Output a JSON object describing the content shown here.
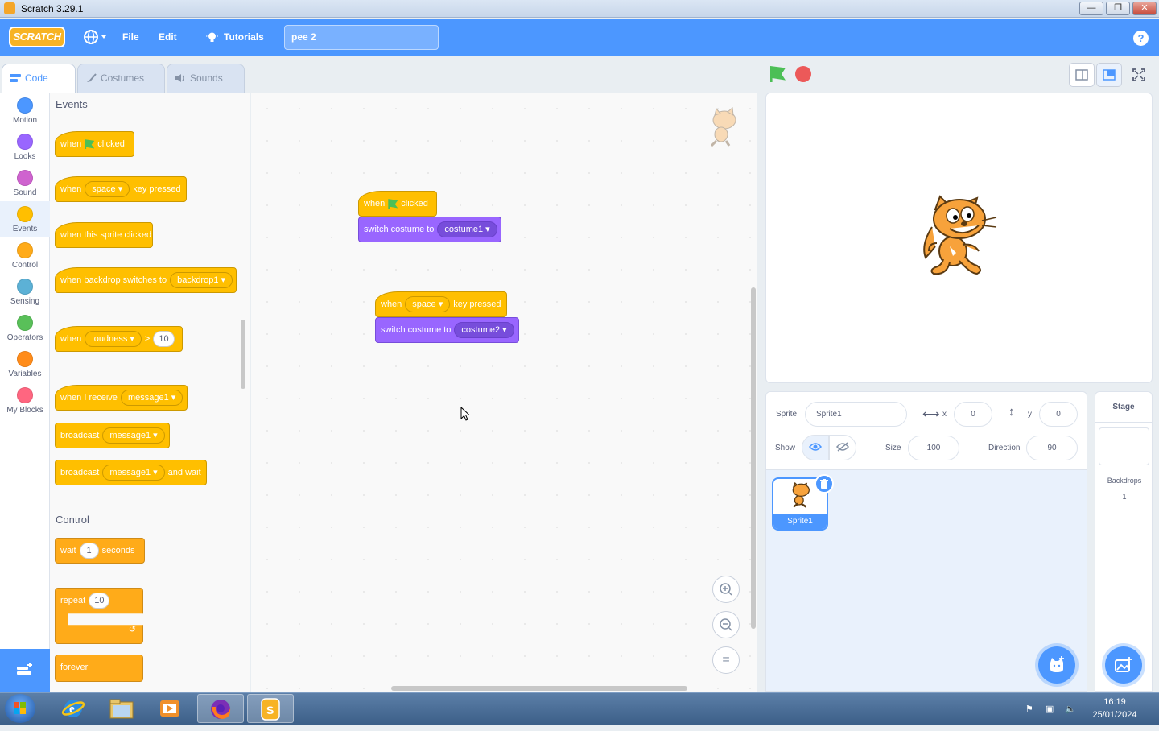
{
  "window": {
    "title": "Scratch 3.29.1",
    "buttons": [
      "—",
      "❐",
      "✕"
    ]
  },
  "menubar": {
    "logo": "SCRATCH",
    "globe_icon": "globe-icon",
    "file": "File",
    "edit": "Edit",
    "tutorials": "Tutorials",
    "project_name": "pee 2",
    "help": "?"
  },
  "tabs": [
    {
      "label": "Code",
      "icon": "code-icon"
    },
    {
      "label": "Costumes",
      "icon": "brush-icon"
    },
    {
      "label": "Sounds",
      "icon": "speaker-icon"
    }
  ],
  "categories": [
    {
      "label": "Motion",
      "color": "#4c97ff"
    },
    {
      "label": "Looks",
      "color": "#9966ff"
    },
    {
      "label": "Sound",
      "color": "#cf63cf"
    },
    {
      "label": "Events",
      "color": "#ffbf00"
    },
    {
      "label": "Control",
      "color": "#ffab19"
    },
    {
      "label": "Sensing",
      "color": "#5cb1d6"
    },
    {
      "label": "Operators",
      "color": "#59c059"
    },
    {
      "label": "Variables",
      "color": "#ff8c1a"
    },
    {
      "label": "My Blocks",
      "color": "#ff6680"
    }
  ],
  "palette": {
    "events_header": "Events",
    "control_header": "Control",
    "b1": {
      "a": "when",
      "b": "clicked"
    },
    "b2": {
      "a": "when",
      "drop": "space",
      "b": "key pressed"
    },
    "b3": {
      "a": "when this sprite clicked"
    },
    "b4": {
      "a": "when backdrop switches to",
      "drop": "backdrop1"
    },
    "b5": {
      "a": "when",
      "drop": "loudness",
      "op": ">",
      "num": "10"
    },
    "b6": {
      "a": "when I receive",
      "drop": "message1"
    },
    "b7": {
      "a": "broadcast",
      "drop": "message1"
    },
    "b8": {
      "a": "broadcast",
      "drop": "message1",
      "b": "and wait"
    },
    "c1": {
      "a": "wait",
      "num": "1",
      "b": "seconds"
    },
    "c2": {
      "a": "repeat",
      "num": "10"
    },
    "c3": {
      "a": "forever"
    }
  },
  "workspace": {
    "script1": {
      "hat_a": "when",
      "hat_b": "clicked",
      "cmd": "switch costume to",
      "drop": "costume1"
    },
    "script2": {
      "hat_a": "when",
      "hat_drop": "space",
      "hat_b": "key pressed",
      "cmd": "switch costume to",
      "drop": "costume2"
    },
    "zoom_in": "+",
    "zoom_out": "−",
    "zoom_reset": "="
  },
  "sprite_info": {
    "sprite_label": "Sprite",
    "sprite_name": "Sprite1",
    "x_label": "x",
    "x": "0",
    "y_label": "y",
    "y": "0",
    "show_label": "Show",
    "size_label": "Size",
    "size": "100",
    "direction_label": "Direction",
    "direction": "90"
  },
  "sprite_list": [
    {
      "name": "Sprite1"
    }
  ],
  "stage_pane": {
    "title": "Stage",
    "backdrops_label": "Backdrops",
    "backdrops_count": "1"
  },
  "taskbar": {
    "time": "16:19",
    "date": "25/01/2024"
  }
}
